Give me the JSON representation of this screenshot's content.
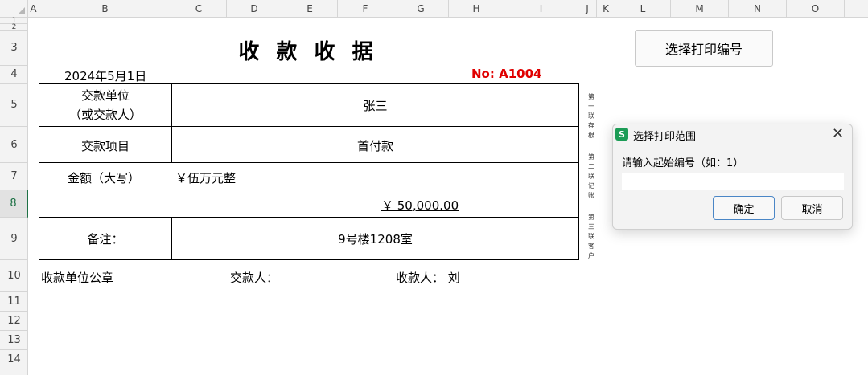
{
  "sheet": {
    "columns": [
      "A",
      "B",
      "C",
      "D",
      "E",
      "F",
      "G",
      "H",
      "I",
      "J",
      "K",
      "L",
      "M",
      "N",
      "O"
    ],
    "rows": [
      "1",
      "2",
      "3",
      "4",
      "5",
      "6",
      "7",
      "8",
      "9",
      "10",
      "11",
      "12",
      "13",
      "14"
    ],
    "active_row": "8"
  },
  "receipt": {
    "title": "收 款 收 据",
    "date": "2024年5月1日",
    "no": "No:  A1004",
    "payer_label": "交款单位",
    "payer_label2": "（或交款人）",
    "payer_value": "张三",
    "item_label": "交款项目",
    "item_value": "首付款",
    "amount_label": "金额（大写）",
    "amount_words": "￥伍万元整",
    "amount_number": "￥ 50,000.00",
    "remark_label": "备注：",
    "remark_value": "9号楼1208室",
    "footer_seal": "收款单位公章",
    "footer_payer": "交款人：",
    "footer_payee": "收款人：  刘"
  },
  "side_notes": [
    "第一联存根",
    "第二联记账",
    "第三联客户"
  ],
  "print_button": "选择打印编号",
  "dialog": {
    "icon": "S",
    "title": "选择打印范围",
    "close": "✕",
    "prompt": "请输入起始编号（如：1）",
    "input_value": "",
    "ok": "确定",
    "cancel": "取消"
  },
  "colors": {
    "accent_green": "#1e7145",
    "number_red": "#e00000",
    "app_icon_green": "#1c9c56"
  }
}
